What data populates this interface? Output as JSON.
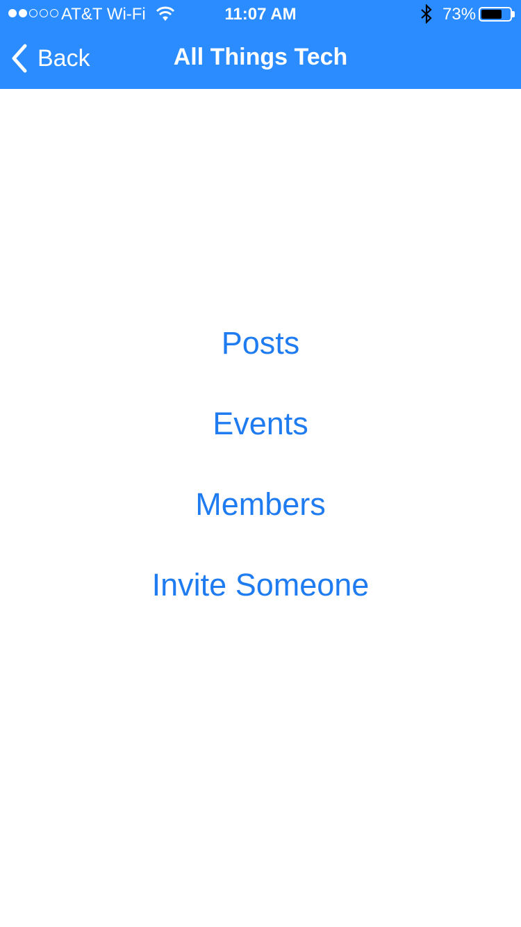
{
  "status_bar": {
    "carrier": "AT&T Wi-Fi",
    "time": "11:07 AM",
    "battery_percent": "73%",
    "battery_level": 0.73,
    "signal_bars_filled": 2,
    "signal_bars_total": 5,
    "icons": [
      "wifi-icon",
      "bluetooth-icon",
      "battery-icon"
    ]
  },
  "nav": {
    "back_label": "Back",
    "title": "All Things Tech",
    "bar_color": "#2a8cff"
  },
  "menu": {
    "items": [
      {
        "label": "Posts"
      },
      {
        "label": "Events"
      },
      {
        "label": "Members"
      },
      {
        "label": "Invite Someone"
      }
    ],
    "link_color": "#1e7bf0"
  }
}
